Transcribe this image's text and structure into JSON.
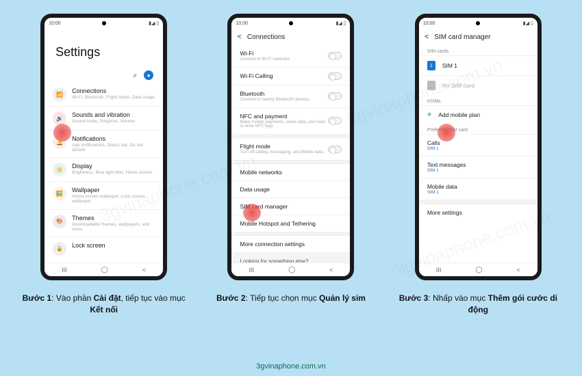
{
  "status": {
    "time": "10:00"
  },
  "phone1": {
    "title": "Settings",
    "rows": [
      {
        "icon": "📶",
        "cls": "ic-blue",
        "title": "Connections",
        "sub": "Wi-Fi, Bluetooth, Flight mode, Data usage"
      },
      {
        "icon": "🔊",
        "cls": "ic-pink",
        "title": "Sounds and vibration",
        "sub": "Sound mode, Ringtone, Volume"
      },
      {
        "icon": "🔔",
        "cls": "ic-red",
        "title": "Notifications",
        "sub": "App notifications, Status bar, Do not disturb"
      },
      {
        "icon": "🔆",
        "cls": "ic-green",
        "title": "Display",
        "sub": "Brightness, Blue light filter, Home screen"
      },
      {
        "icon": "🖼️",
        "cls": "ic-orange",
        "title": "Wallpaper",
        "sub": "Home screen wallpaper, Lock screen wallpaper"
      },
      {
        "icon": "🎨",
        "cls": "ic-purple",
        "title": "Themes",
        "sub": "Downloadable themes, wallpapers, and icons"
      },
      {
        "icon": "🔒",
        "cls": "ic-gray",
        "title": "Lock screen",
        "sub": ""
      }
    ]
  },
  "phone2": {
    "title": "Connections",
    "rows_a": [
      {
        "title": "Wi-Fi",
        "sub": "Connect to Wi-Fi networks",
        "toggle": true
      },
      {
        "title": "Wi-Fi Calling",
        "sub": "",
        "toggle": true
      },
      {
        "title": "Bluetooth",
        "sub": "Connect to nearby Bluetooth devices.",
        "toggle": true
      },
      {
        "title": "NFC and payment",
        "sub": "Make mobile payments, share data, and read or write NFC tags",
        "toggle": true
      }
    ],
    "rows_b": [
      {
        "title": "Flight mode",
        "sub": "Turn off calling, messaging, and Mobile data.",
        "toggle": true
      }
    ],
    "rows_c": [
      {
        "title": "Mobile networks"
      },
      {
        "title": "Data usage"
      },
      {
        "title": "SIM card manager"
      },
      {
        "title": "Mobile Hotspot and Tethering"
      }
    ],
    "rows_d": [
      {
        "title": "More connection settings"
      }
    ],
    "looking": "Looking for something else?"
  },
  "phone3": {
    "title": "SIM card manager",
    "section_sim": "SIM cards",
    "sim1": "SIM 1",
    "nosim": "No SIM card",
    "section_esim": "eSIMs",
    "add_plan": "Add mobile plan",
    "section_pref": "Preferred SIM card",
    "calls": "Calls",
    "calls_sub": "SIM 1",
    "texts": "Text messages",
    "texts_sub": "SIM 1",
    "mdata": "Mobile data",
    "mdata_sub": "SIM 1",
    "more": "More settings"
  },
  "captions": {
    "c1_prefix": "Bước 1",
    "c1_a": ": Vào phần ",
    "c1_b": "Cài đặt",
    "c1_c": ", tiếp tục vào mục ",
    "c1_d": "Kết nối",
    "c2_prefix": "Bước 2",
    "c2_a": ": Tiếp tục chọn mục ",
    "c2_b": "Quản lý sim",
    "c3_prefix": "Bước 3",
    "c3_a": ": Nhấp vào mục ",
    "c3_b": "Thêm gói cước di động"
  },
  "footer": "3gvinaphone.com.vn",
  "watermark": "3gvinaphone.com.vn",
  "nav": {
    "recent": "III",
    "home": "◯",
    "back": "<"
  }
}
